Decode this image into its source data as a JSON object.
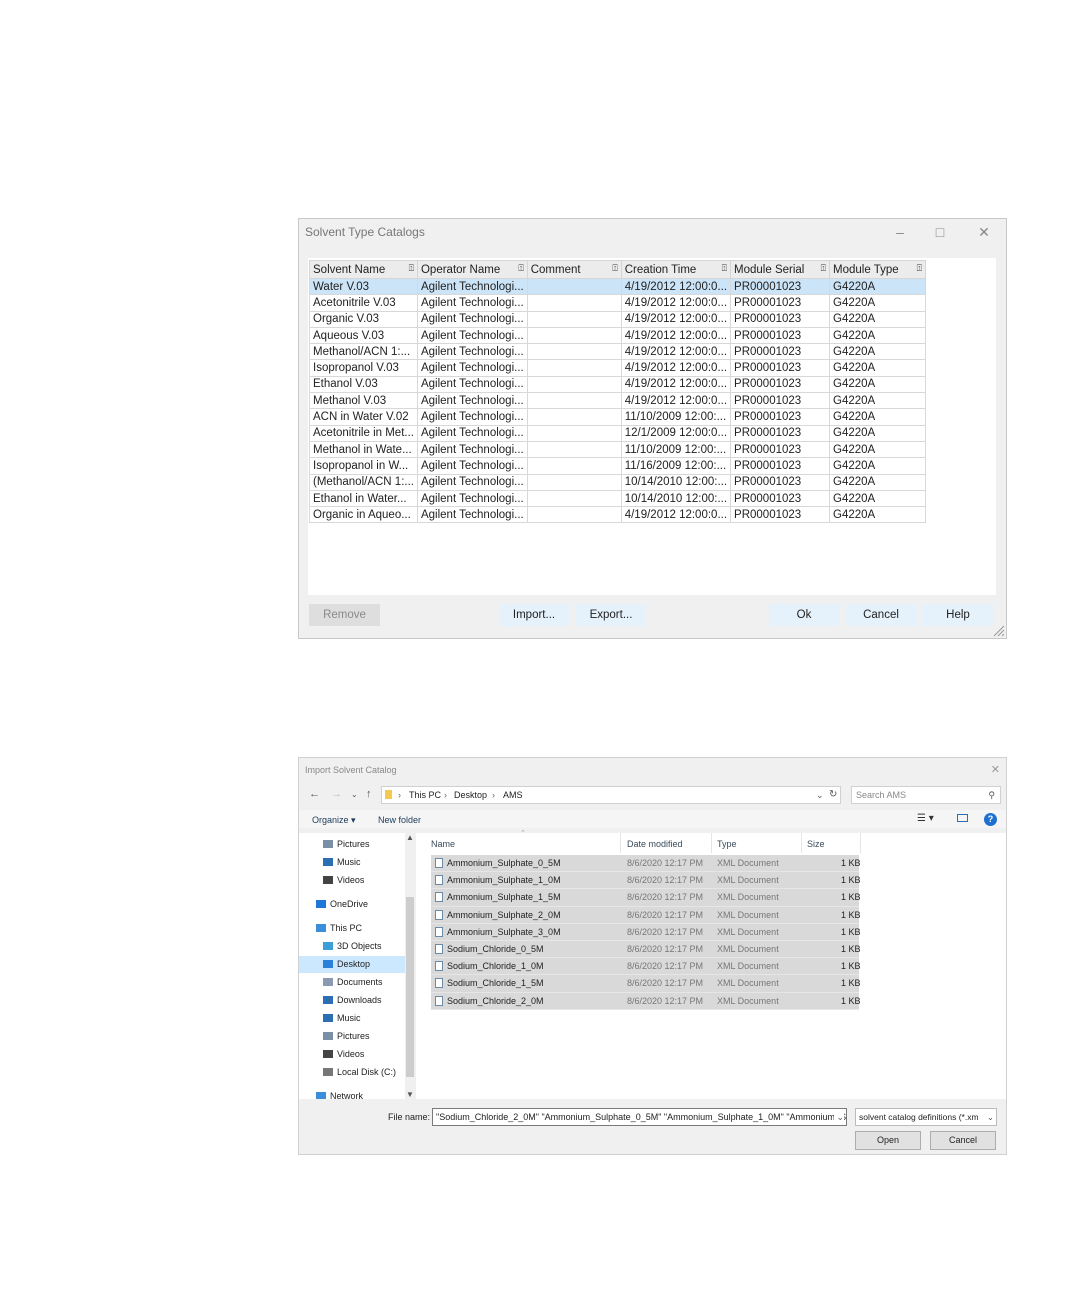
{
  "solvent_dialog": {
    "title": "Solvent Type Catalogs",
    "columns": [
      "Solvent Name",
      "Operator Name",
      "Comment",
      "Creation Time",
      "Module Serial",
      "Module Type"
    ],
    "rows": [
      [
        "Water V.03",
        "Agilent Technologi...",
        "",
        "4/19/2012  12:00:0...",
        "PR00001023",
        "G4220A"
      ],
      [
        "Acetonitrile V.03",
        "Agilent Technologi...",
        "",
        "4/19/2012  12:00:0...",
        "PR00001023",
        "G4220A"
      ],
      [
        "Organic V.03",
        "Agilent Technologi...",
        "",
        "4/19/2012  12:00:0...",
        "PR00001023",
        "G4220A"
      ],
      [
        "Aqueous V.03",
        "Agilent Technologi...",
        "",
        "4/19/2012  12:00:0...",
        "PR00001023",
        "G4220A"
      ],
      [
        "Methanol/ACN  1:...",
        "Agilent Technologi...",
        "",
        "4/19/2012  12:00:0...",
        "PR00001023",
        "G4220A"
      ],
      [
        "Isopropanol V.03",
        "Agilent Technologi...",
        "",
        "4/19/2012  12:00:0...",
        "PR00001023",
        "G4220A"
      ],
      [
        "Ethanol V.03",
        "Agilent Technologi...",
        "",
        "4/19/2012  12:00:0...",
        "PR00001023",
        "G4220A"
      ],
      [
        "Methanol V.03",
        "Agilent Technologi...",
        "",
        "4/19/2012  12:00:0...",
        "PR00001023",
        "G4220A"
      ],
      [
        "ACN in Water V.02",
        "Agilent Technologi...",
        "",
        "11/10/2009  12:00:...",
        "PR00001023",
        "G4220A"
      ],
      [
        "Acetonitrile in Met...",
        "Agilent Technologi...",
        "",
        "12/1/2009  12:00:0...",
        "PR00001023",
        "G4220A"
      ],
      [
        "Methanol  in  Wate...",
        "Agilent Technologi...",
        "",
        "11/10/2009  12:00:...",
        "PR00001023",
        "G4220A"
      ],
      [
        "Isopropanol  in  W...",
        "Agilent Technologi...",
        "",
        "11/16/2009  12:00:...",
        "PR00001023",
        "G4220A"
      ],
      [
        "(Methanol/ACN  1:...",
        "Agilent Technologi...",
        "",
        "10/14/2010  12:00:...",
        "PR00001023",
        "G4220A"
      ],
      [
        "Ethanol  in Water...",
        "Agilent Technologi...",
        "",
        "10/14/2010  12:00:...",
        "PR00001023",
        "G4220A"
      ],
      [
        "Organic  in Aqueo...",
        "Agilent Technologi...",
        "",
        "4/19/2012  12:00:0...",
        "PR00001023",
        "G4220A"
      ]
    ],
    "buttons": {
      "remove": "Remove",
      "import": "Import...",
      "export": "Export...",
      "ok": "Ok",
      "cancel": "Cancel",
      "help": "Help"
    }
  },
  "import_dialog": {
    "title": "Import Solvent Catalog",
    "breadcrumb": [
      "This PC",
      "Desktop",
      "AMS"
    ],
    "search_placeholder": "Search AMS",
    "toolbar": {
      "organize": "Organize ▾",
      "new_folder": "New folder"
    },
    "nav_items": [
      {
        "label": "Pictures",
        "icon": "pictures-icon"
      },
      {
        "label": "Music",
        "icon": "music-icon"
      },
      {
        "label": "Videos",
        "icon": "videos-icon"
      },
      {
        "label": "OneDrive",
        "icon": "cloud-icon"
      },
      {
        "label": "This PC",
        "icon": "computer-icon"
      },
      {
        "label": "3D Objects",
        "icon": "3d-objects-icon"
      },
      {
        "label": "Desktop",
        "icon": "desktop-icon"
      },
      {
        "label": "Documents",
        "icon": "documents-icon"
      },
      {
        "label": "Downloads",
        "icon": "downloads-icon"
      },
      {
        "label": "Music",
        "icon": "music-icon"
      },
      {
        "label": "Pictures",
        "icon": "pictures-icon"
      },
      {
        "label": "Videos",
        "icon": "videos-icon"
      },
      {
        "label": "Local Disk (C:)",
        "icon": "disk-icon"
      },
      {
        "label": "Network",
        "icon": "network-icon"
      }
    ],
    "file_columns": {
      "name": "Name",
      "date": "Date modified",
      "type": "Type",
      "size": "Size"
    },
    "files": [
      {
        "name": "Ammonium_Sulphate_0_5M",
        "date": "8/6/2020 12:17 PM",
        "type": "XML Document",
        "size": "1 KB"
      },
      {
        "name": "Ammonium_Sulphate_1_0M",
        "date": "8/6/2020 12:17 PM",
        "type": "XML Document",
        "size": "1 KB"
      },
      {
        "name": "Ammonium_Sulphate_1_5M",
        "date": "8/6/2020 12:17 PM",
        "type": "XML Document",
        "size": "1 KB"
      },
      {
        "name": "Ammonium_Sulphate_2_0M",
        "date": "8/6/2020 12:17 PM",
        "type": "XML Document",
        "size": "1 KB"
      },
      {
        "name": "Ammonium_Sulphate_3_0M",
        "date": "8/6/2020 12:17 PM",
        "type": "XML Document",
        "size": "1 KB"
      },
      {
        "name": "Sodium_Chloride_0_5M",
        "date": "8/6/2020 12:17 PM",
        "type": "XML Document",
        "size": "1 KB"
      },
      {
        "name": "Sodium_Chloride_1_0M",
        "date": "8/6/2020 12:17 PM",
        "type": "XML Document",
        "size": "1 KB"
      },
      {
        "name": "Sodium_Chloride_1_5M",
        "date": "8/6/2020 12:17 PM",
        "type": "XML Document",
        "size": "1 KB"
      },
      {
        "name": "Sodium_Chloride_2_0M",
        "date": "8/6/2020 12:17 PM",
        "type": "XML Document",
        "size": "1 KB"
      }
    ],
    "file_name_label": "File name:",
    "file_name_value": "\"Sodium_Chloride_2_0M\" \"Ammonium_Sulphate_0_5M\" \"Ammonium_Sulphate_1_0M\" \"Ammonium_S",
    "file_type": "solvent catalog definitions (*.xm",
    "buttons": {
      "open": "Open",
      "cancel": "Cancel"
    }
  }
}
